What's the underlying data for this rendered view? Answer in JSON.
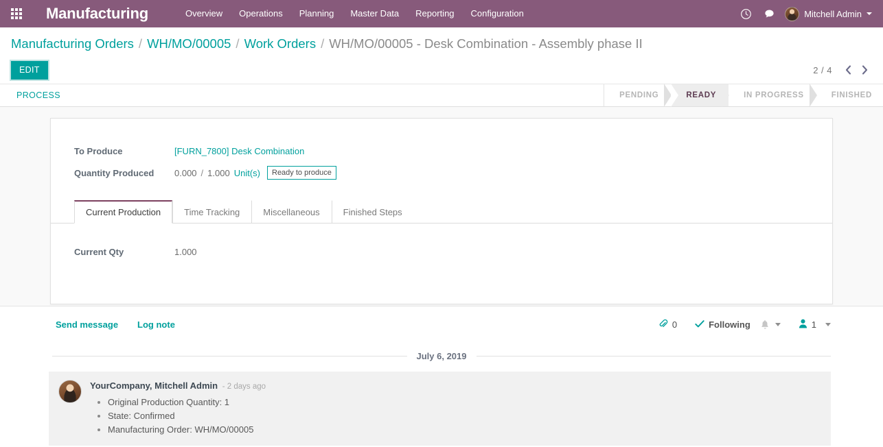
{
  "navbar": {
    "apps_icon": "apps-grid-icon",
    "brand": "Manufacturing",
    "menus": [
      "Overview",
      "Operations",
      "Planning",
      "Master Data",
      "Reporting",
      "Configuration"
    ],
    "activity_icon": "clock-icon",
    "messaging_icon": "chat-bubble-icon",
    "user_name": "Mitchell Admin",
    "brand_color": "#875a7b"
  },
  "breadcrumb": {
    "items": [
      {
        "label": "Manufacturing Orders",
        "active": false
      },
      {
        "label": "WH/MO/00005",
        "active": false
      },
      {
        "label": "Work Orders",
        "active": false
      },
      {
        "label": "WH/MO/00005 - Desk Combination - Assembly phase II",
        "active": true
      }
    ],
    "separator": "/",
    "link_color": "#00a09d"
  },
  "controls": {
    "edit_label": "EDIT",
    "pager_value": "2 / 4",
    "pager_prev_icon": "chevron-left-icon",
    "pager_next_icon": "chevron-right-icon"
  },
  "statusbar": {
    "buttons": [
      "PROCESS"
    ],
    "steps": [
      {
        "label": "PENDING",
        "active": false
      },
      {
        "label": "READY",
        "active": true
      },
      {
        "label": "IN PROGRESS",
        "active": false
      },
      {
        "label": "FINISHED",
        "active": false
      }
    ],
    "active_color": "#5c3a50"
  },
  "form": {
    "fields": [
      {
        "label": "To Produce",
        "value": "[FURN_7800] Desk Combination",
        "type": "link"
      },
      {
        "label": "Quantity Produced",
        "qty_done": "0.000",
        "separator": "/",
        "qty_total": "1.000",
        "uom": "Unit(s)",
        "badge": "Ready to produce",
        "type": "quantity"
      }
    ],
    "tabs": [
      {
        "label": "Current Production",
        "active": true
      },
      {
        "label": "Time Tracking",
        "active": false
      },
      {
        "label": "Miscellaneous",
        "active": false
      },
      {
        "label": "Finished Steps",
        "active": false
      }
    ],
    "tab_content": {
      "fields": [
        {
          "label": "Current Qty",
          "value": "1.000"
        }
      ]
    }
  },
  "chatter": {
    "send_message": "Send message",
    "log_note": "Log note",
    "attachment_icon": "paperclip-icon",
    "attachment_count": "0",
    "follow_icon": "check-icon",
    "following_label": "Following",
    "bell_icon": "bell-icon",
    "followers_icon": "user-icon",
    "followers_count": "1",
    "date_divider": "July 6, 2019",
    "messages": [
      {
        "avatar": "user-avatar",
        "author": "YourCompany, Mitchell Admin",
        "time": "- 2 days ago",
        "lines": [
          "Original Production Quantity: 1",
          "State: Confirmed",
          "Manufacturing Order: WH/MO/00005"
        ]
      }
    ]
  }
}
